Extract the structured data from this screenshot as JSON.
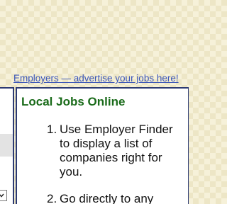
{
  "header": {
    "advertise_link": "Employers — advertise your jobs here!"
  },
  "panel": {
    "title": "Local Jobs Online",
    "steps": [
      {
        "number": "1.",
        "text": "Use Employer Finder to display a list of companies right for you."
      },
      {
        "number": "2.",
        "text": "Go directly to any"
      }
    ]
  },
  "icons": {
    "dropdown": "chevron-down-icon"
  }
}
